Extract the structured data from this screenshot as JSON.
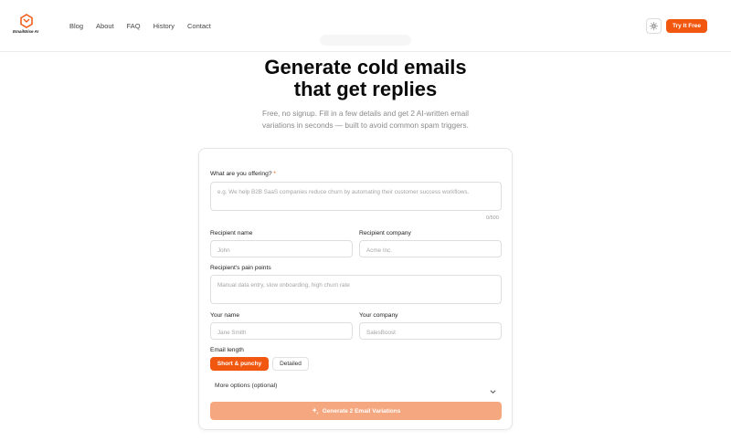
{
  "header": {
    "logo_text": "EmailWise AI",
    "nav": [
      "Blog",
      "About",
      "FAQ",
      "History",
      "Contact"
    ],
    "cta_label": "Try It Free",
    "brand_color": "#f2570f"
  },
  "hero": {
    "title_line1": "Generate cold emails",
    "title_line2": "that get replies",
    "subtitle_line1": "Free, no signup. Fill in a few details and get 2 AI-written email",
    "subtitle_line2": "variations in seconds — built to avoid common spam triggers."
  },
  "form": {
    "offering_label": "What are you offering?",
    "offering_required_mark": "*",
    "offering_placeholder": "e.g. We help B2B SaaS companies reduce churn by automating their customer success workflows.",
    "offering_counter": "0/500",
    "recipient_name_label": "Recipient name",
    "recipient_name_placeholder": "John",
    "recipient_company_label": "Recipient company",
    "recipient_company_placeholder": "Acme Inc.",
    "pain_points_label": "Recipient's pain points",
    "pain_points_placeholder": "Manual data entry, slow onboarding, high churn rate",
    "your_name_label": "Your name",
    "your_name_placeholder": "Jane Smith",
    "your_company_label": "Your company",
    "your_company_placeholder": "SalesBoost",
    "email_length_label": "Email length",
    "length_options": [
      "Short & punchy",
      "Detailed"
    ],
    "length_selected": "Short & punchy",
    "more_options_label": "More options (optional)",
    "generate_label": "Generate 2 Email Variations"
  }
}
